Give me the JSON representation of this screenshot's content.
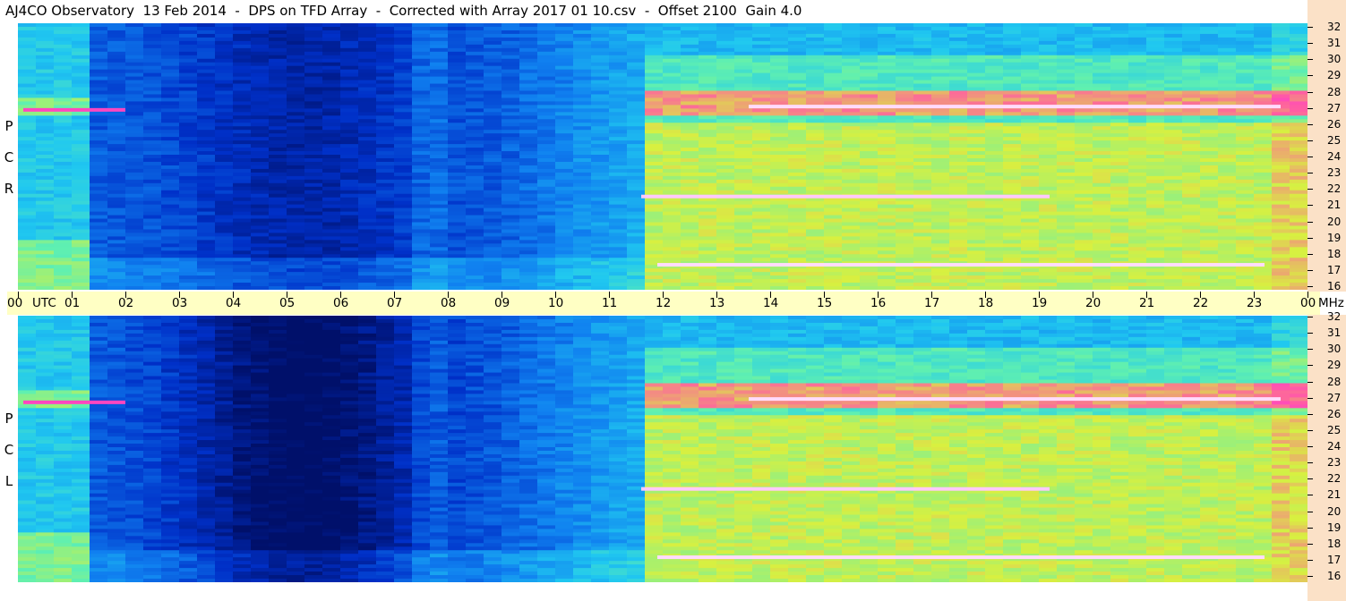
{
  "title": "AJ4CO Observatory  13 Feb 2014  -  DPS on TFD Array  -  Corrected with Array 2017 01 10.csv  -  Offset 2100  Gain 4.0",
  "side_labels": {
    "top": [
      "P",
      "C",
      "R"
    ],
    "bottom": [
      "P",
      "C",
      "L"
    ]
  },
  "chart_data": {
    "type": "heatmap",
    "panels": [
      {
        "polarization": "RCP",
        "x_range_utc_hours": [
          0,
          24
        ],
        "y_range_mhz": [
          16,
          32
        ]
      },
      {
        "polarization": "LCP",
        "x_range_utc_hours": [
          0,
          24
        ],
        "y_range_mhz": [
          16,
          32
        ]
      }
    ],
    "x_tick_labels": [
      "00",
      "01",
      "02",
      "03",
      "04",
      "05",
      "06",
      "07",
      "08",
      "09",
      "10",
      "11",
      "12",
      "13",
      "14",
      "15",
      "16",
      "17",
      "18",
      "19",
      "20",
      "21",
      "22",
      "23",
      "00"
    ],
    "x_unit_label": "UTC",
    "y_tick_labels": [
      "32",
      "31",
      "30",
      "29",
      "28",
      "27",
      "26",
      "25",
      "24",
      "23",
      "22",
      "21",
      "20",
      "19",
      "18",
      "17",
      "16"
    ],
    "y_unit_label": "MHz",
    "colormap": [
      "#00106a",
      "#0030c8",
      "#1080f0",
      "#20c8f0",
      "#60f0b0",
      "#d8f040",
      "#ff60a0",
      "#ff20f0",
      "#ffffff"
    ]
  }
}
